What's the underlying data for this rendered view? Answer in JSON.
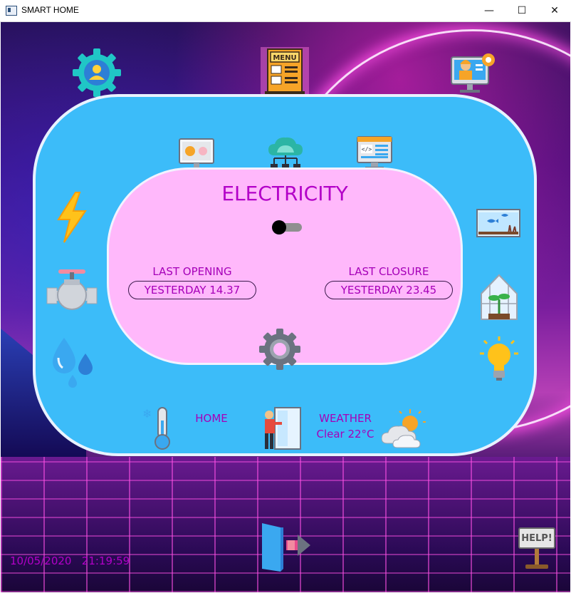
{
  "window": {
    "title": "SMART HOME",
    "min_glyph": "—",
    "max_glyph": "☐",
    "close_glyph": "✕"
  },
  "top_icons": {
    "profile": "profile-gear-icon",
    "menu": "menu-icon",
    "technician": "technician-computer-icon"
  },
  "panel": {
    "top_icons": [
      "remote-control-icon",
      "cloud-network-icon",
      "code-screen-icon"
    ],
    "left_icons": [
      "electricity-bolt-icon",
      "water-valve-icon",
      "water-drops-icon"
    ],
    "right_icons": [
      "aquarium-icon",
      "greenhouse-icon",
      "light-bulb-icon"
    ]
  },
  "electricity": {
    "heading": "ELECTRICITY",
    "switch_on": false,
    "last_opening_label": "LAST OPENING",
    "last_opening_value": "YESTERDAY  14.37",
    "last_closure_label": "LAST CLOSURE",
    "last_closure_value": "YESTERDAY 23.45"
  },
  "status": {
    "home_label": "HOME",
    "weather_label": "WEATHER",
    "weather_value": "Clear 22°C"
  },
  "footer": {
    "date": "10/05/2020",
    "time": "21:19:59",
    "help_label": "HELP!"
  },
  "colors": {
    "panel_blue": "#3cbcf9",
    "inner_pink": "#ffb8fb",
    "text_purple": "#a600b8"
  }
}
